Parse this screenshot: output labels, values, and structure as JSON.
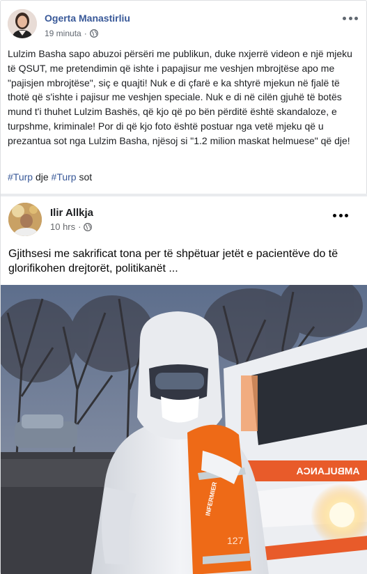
{
  "post": {
    "author": "Ogerta Manastirliu",
    "time": "19 minuta",
    "separator": "·",
    "privacy_icon": "globe-icon",
    "more_icon": "more-options-icon",
    "text": "Lulzim Basha sapo abuzoi përsëri me publikun, duke nxjerrë videon e një mjeku të QSUT, me pretendimin që ishte i papajisur me veshjen mbrojtëse apo me \"pajisjen mbrojtëse\", siç e quajti! Nuk e di çfarë e ka shtyrë mjekun në fjalë të thotë që s'ishte i pajisur me veshjen speciale. Nuk e di në cilën gjuhë të botës mund t'i thuhet Lulzim Bashës, që kjo që po bën përditë është skandaloze, e turpshme, kriminale! Por di që kjo foto është postuar nga vetë mjeku që u prezantua sot nga Lulzim Basha, njësoj si \"1.2 milion maskat helmuese\" që dje!",
    "hashtag1": "#Turp",
    "hashtag_between": " dje ",
    "hashtag2": "#Turp",
    "hashtag_after": " sot"
  },
  "shared": {
    "author": "Ilir Allkja",
    "time": "10 hrs",
    "separator": "·",
    "privacy_icon": "globe-icon",
    "more_icon": "more-options-icon",
    "text": "Gjithsesi me sakrificat tona per të shpëtuar jetët e pacientëve do të glorifikohen drejtorët, politikanët ...",
    "photo_text": {
      "ambulance": "AMBULANCA",
      "vest_label": "INFERMIER",
      "vest_number": "127"
    }
  },
  "colors": {
    "link": "#385898",
    "text": "#1c1e21",
    "meta": "#606770",
    "divider": "#e9ebee",
    "vest_orange": "#ee6a17"
  }
}
